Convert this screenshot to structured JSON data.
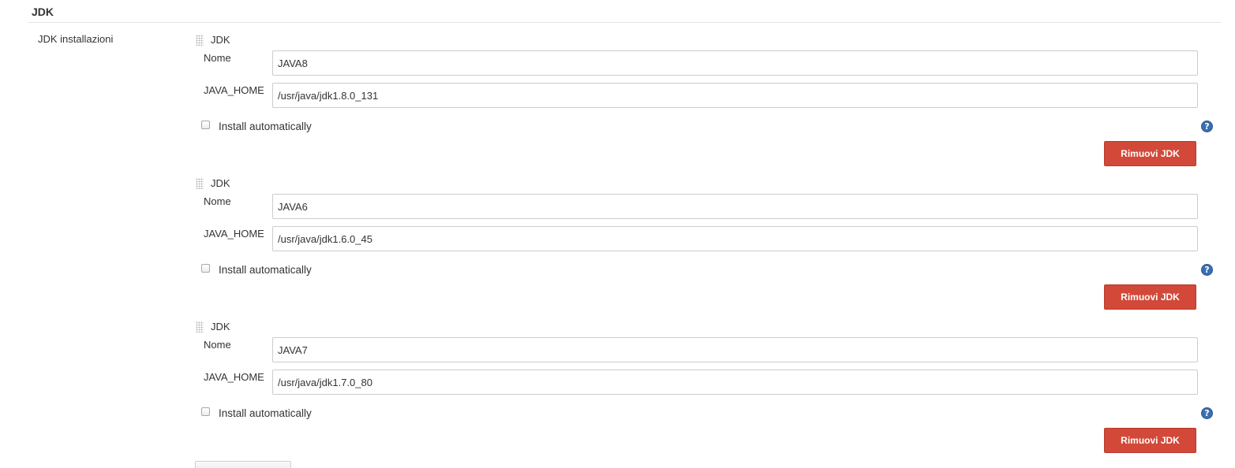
{
  "section": {
    "title": "JDK",
    "label": "JDK installazioni"
  },
  "jdks": [
    {
      "title": "JDK",
      "name_label": "Nome",
      "name_value": "JAVA8",
      "home_label": "JAVA_HOME",
      "home_value": "/usr/java/jdk1.8.0_131",
      "install_label": "Install automatically",
      "install_checked": false,
      "remove_label": "Rimuovi JDK"
    },
    {
      "title": "JDK",
      "name_label": "Nome",
      "name_value": "JAVA6",
      "home_label": "JAVA_HOME",
      "home_value": "/usr/java/jdk1.6.0_45",
      "install_label": "Install automatically",
      "install_checked": false,
      "remove_label": "Rimuovi JDK"
    },
    {
      "title": "JDK",
      "name_label": "Nome",
      "name_value": "JAVA7",
      "home_label": "JAVA_HOME",
      "home_value": "/usr/java/jdk1.7.0_80",
      "install_label": "Install automatically",
      "install_checked": false,
      "remove_label": "Rimuovi JDK"
    }
  ],
  "icons": {
    "drag": "drag-handle-icon",
    "help": "help-icon"
  },
  "colors": {
    "remove_button": "#d24939",
    "help_icon": "#3a6fb0"
  }
}
